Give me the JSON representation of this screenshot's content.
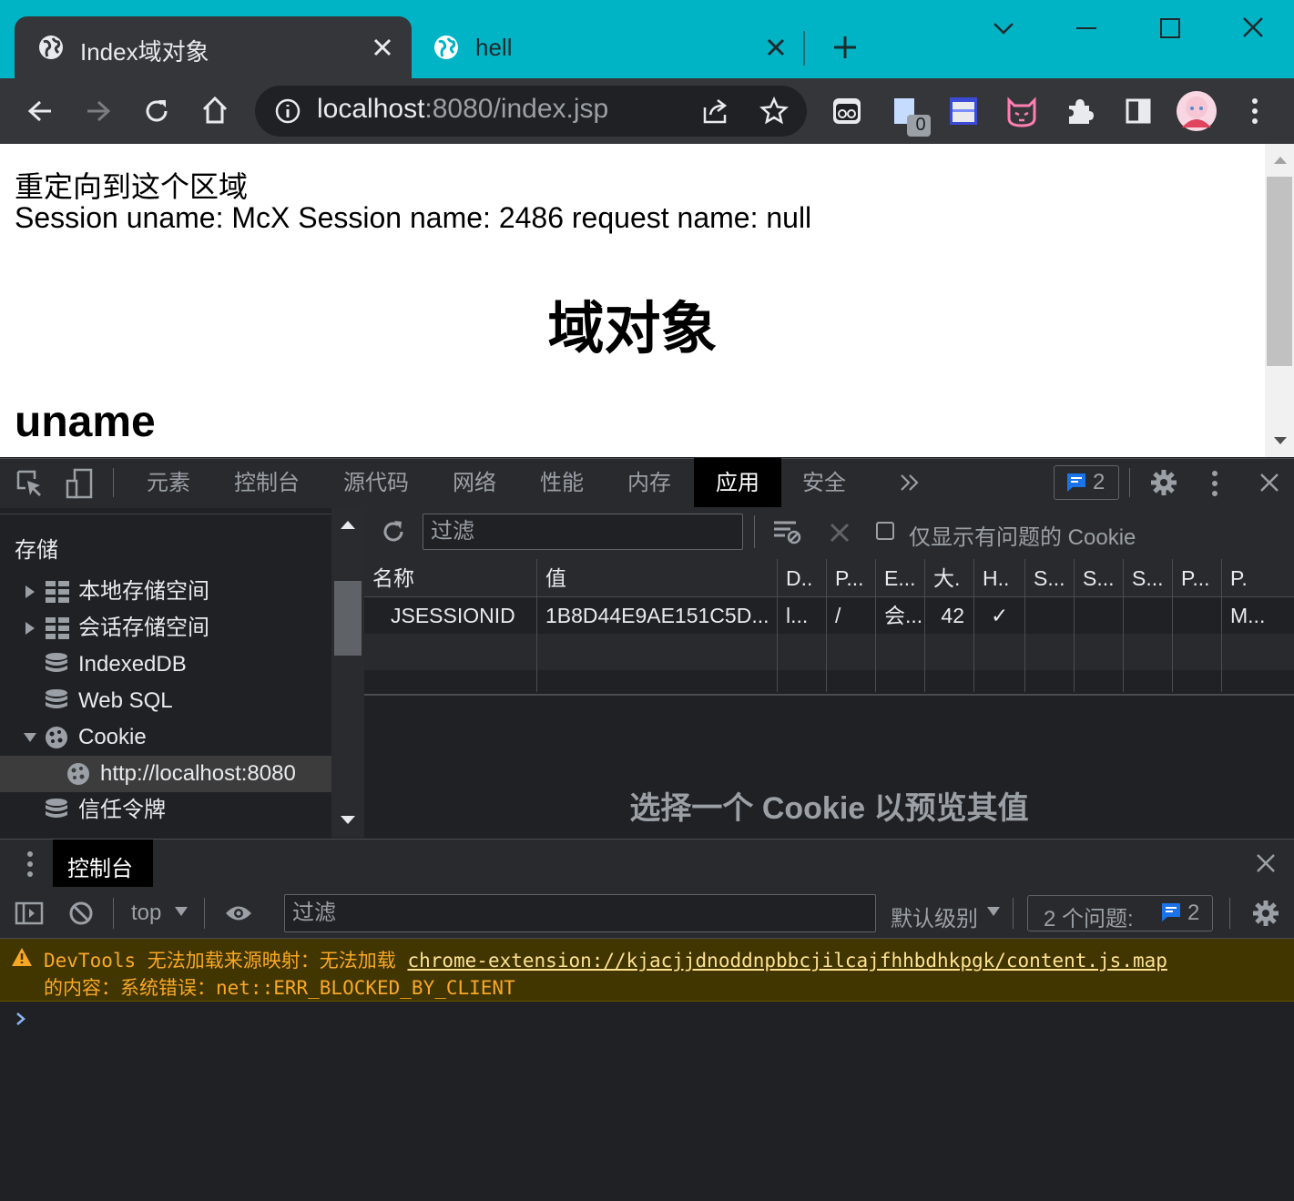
{
  "browser": {
    "tabs": [
      {
        "title": "Index域对象",
        "active": true
      },
      {
        "title": "hell",
        "active": false
      }
    ],
    "omnibox": {
      "host": "localhost",
      "rest": ":8080/index.jsp"
    },
    "extension_badge": "0"
  },
  "page": {
    "line1": "重定向到这个区域",
    "line2": "Session uname: McX Session name: 2486 request name: null",
    "heading": "域对象",
    "subheading": "uname"
  },
  "devtools": {
    "tabs": [
      "元素",
      "控制台",
      "源代码",
      "网络",
      "性能",
      "内存",
      "应用",
      "安全"
    ],
    "active_tab": "应用",
    "issues_count": "2",
    "sidebar": {
      "section": "存储",
      "items": [
        {
          "label": "本地存储空间",
          "icon": "grid-icon",
          "expandable": true
        },
        {
          "label": "会话存储空间",
          "icon": "grid-icon",
          "expandable": true
        },
        {
          "label": "IndexedDB",
          "icon": "database-icon"
        },
        {
          "label": "Web SQL",
          "icon": "database-icon"
        },
        {
          "label": "Cookie",
          "icon": "cookie-icon",
          "expanded": true
        },
        {
          "label": "http://localhost:8080",
          "icon": "cookie-icon",
          "selected": true
        },
        {
          "label": "信任令牌",
          "icon": "database-icon"
        }
      ]
    },
    "cookies": {
      "filter_placeholder": "过滤",
      "only_issues_label": "仅显示有问题的 Cookie",
      "columns": [
        "名称",
        "值",
        "D..",
        "P...",
        "E...",
        "大.",
        "H..",
        "S...",
        "S...",
        "S...",
        "P...",
        "P."
      ],
      "rows": [
        [
          "JSESSIONID",
          "1B8D44E9AE151C5D...",
          "l...",
          "/",
          "会...",
          "42",
          "✓",
          "",
          "",
          "",
          "",
          "M..."
        ]
      ],
      "preview_text": "选择一个 Cookie 以预览其值"
    },
    "drawer": {
      "tab": "控制台",
      "context": "top",
      "filter_placeholder": "过滤",
      "level": "默认级别",
      "issues_label": "2 个问题:",
      "issues_count": "2",
      "warning": {
        "prefix": "DevTools 无法加载来源映射：无法加载",
        "link": "chrome-extension://kjacjjdnoddnpbbcjilcajfhhbdhkpgk/content.js.map",
        "suffix": "的内容：系统错误：net::ERR_BLOCKED_BY_CLIENT"
      }
    }
  },
  "colors": {
    "titlebar": "#00b4c6",
    "toolbar": "#35363a",
    "devtools_bg": "#202124",
    "warning_bg": "#413500",
    "warning_text": "#f9a825",
    "link_accent": "#8ab4f8"
  }
}
